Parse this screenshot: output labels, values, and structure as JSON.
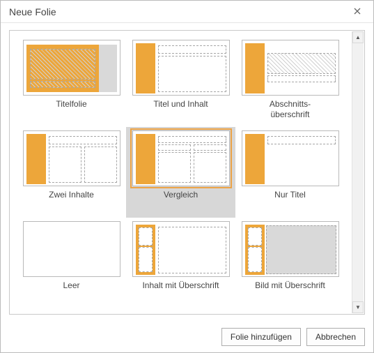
{
  "dialog": {
    "title": "Neue Folie"
  },
  "layouts": [
    {
      "id": "title-slide",
      "label": "Titelfolie",
      "selected": false
    },
    {
      "id": "title-content",
      "label": "Titel und Inhalt",
      "selected": false
    },
    {
      "id": "section-header",
      "label": "Abschnitts-\nüberschrift",
      "selected": false
    },
    {
      "id": "two-content",
      "label": "Zwei Inhalte",
      "selected": false
    },
    {
      "id": "comparison",
      "label": "Vergleich",
      "selected": true
    },
    {
      "id": "title-only",
      "label": "Nur Titel",
      "selected": false
    },
    {
      "id": "blank",
      "label": "Leer",
      "selected": false
    },
    {
      "id": "content-caption",
      "label": "Inhalt mit Überschrift",
      "selected": false
    },
    {
      "id": "picture-caption",
      "label": "Bild mit Überschrift",
      "selected": false
    }
  ],
  "buttons": {
    "add": "Folie hinzufügen",
    "cancel": "Abbrechen"
  },
  "colors": {
    "accent": "#eda63a"
  }
}
